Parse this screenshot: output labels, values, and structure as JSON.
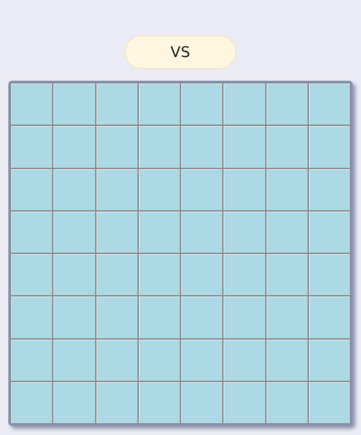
{
  "header": {
    "vs_label": "VS"
  },
  "board": {
    "rows": 8,
    "columns": 8,
    "cell_color": "#add8e6",
    "grid_line_color": "#8d8d8d",
    "frame_color": "#8593b3"
  },
  "colors": {
    "background": "#ececf6",
    "vs_pill_background": "#fff7e0"
  }
}
